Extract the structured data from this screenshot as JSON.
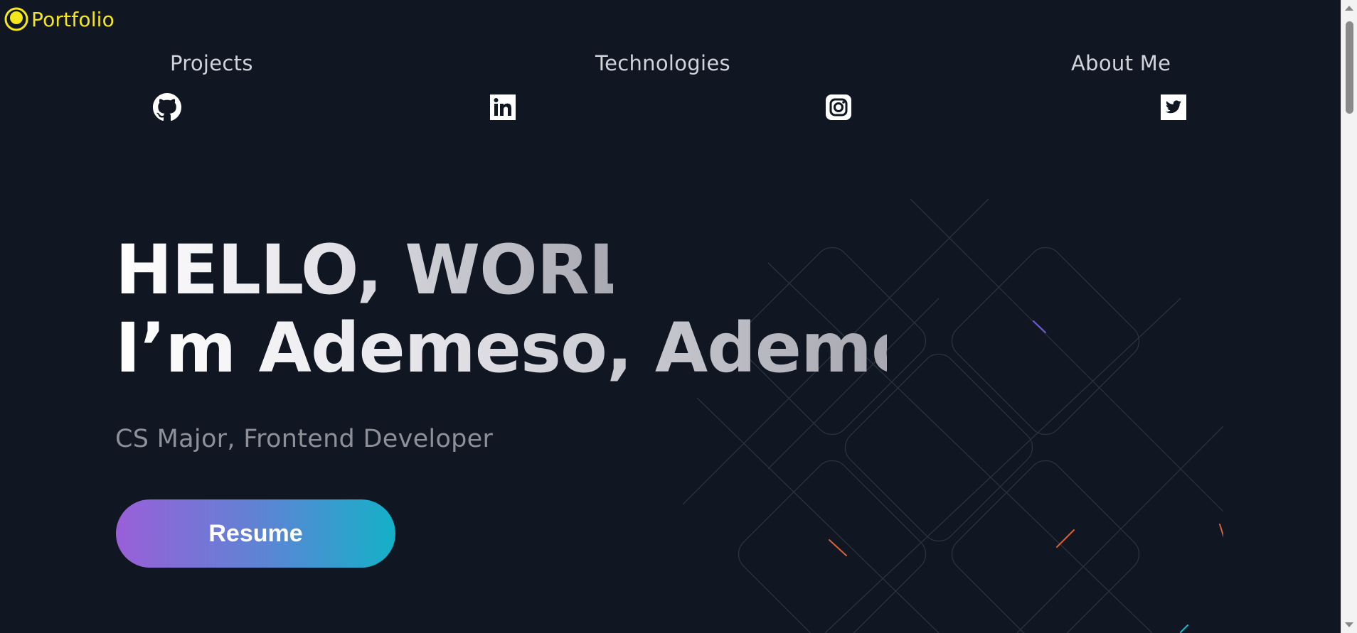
{
  "logo": {
    "text": "Portfolio",
    "icon": "yellow-circle-logo-icon",
    "color": "#f5e61c"
  },
  "nav": {
    "links": [
      {
        "label": "Projects"
      },
      {
        "label": "Technologies"
      },
      {
        "label": "About Me"
      }
    ],
    "socials": [
      {
        "icon": "github-icon"
      },
      {
        "icon": "linkedin-icon"
      },
      {
        "icon": "instagram-icon"
      },
      {
        "icon": "twitter-icon"
      }
    ]
  },
  "hero": {
    "line1": "HELLO, WORLD.",
    "line2": "I’m Ademeso, Ademola.",
    "subtitle": "CS Major, Frontend Developer",
    "button_label": "Resume"
  },
  "colors": {
    "background": "#111722",
    "button_gradient_start": "#9a5fd8",
    "button_gradient_end": "#14b1c8"
  }
}
